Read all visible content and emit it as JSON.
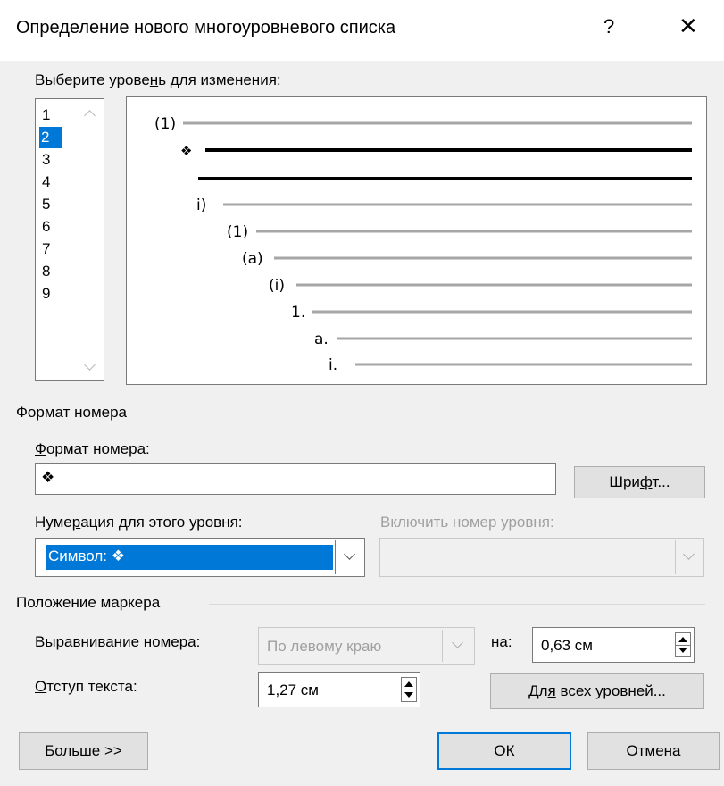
{
  "dialog": {
    "title": "Определение нового многоуровневого списка",
    "help_glyph": "?",
    "close_glyph": "✕"
  },
  "level_select": {
    "label_pre": "Выберите урове",
    "label_u": "н",
    "label_post": "ь для изменения:",
    "levels": [
      "1",
      "2",
      "3",
      "4",
      "5",
      "6",
      "7",
      "8",
      "9"
    ],
    "selected": "2"
  },
  "preview": {
    "rows": [
      {
        "marker": "(1)",
        "style": "gray"
      },
      {
        "marker": "❖",
        "style": "bold"
      },
      {
        "marker": "",
        "style": "bold"
      },
      {
        "marker": "i)",
        "style": "gray"
      },
      {
        "marker": "(1)",
        "style": "gray"
      },
      {
        "marker": "(a)",
        "style": "gray"
      },
      {
        "marker": "(i)",
        "style": "gray"
      },
      {
        "marker": "1.",
        "style": "gray"
      },
      {
        "marker": "a.",
        "style": "gray"
      },
      {
        "marker": "i.",
        "style": "gray"
      }
    ]
  },
  "number_format": {
    "group_label": "Формат номера",
    "format_label_u": "Ф",
    "format_label_post": "ормат номера:",
    "format_value": "❖",
    "font_button_pre": "Шри",
    "font_button_u": "ф",
    "font_button_post": "т...",
    "numbering_label_pre": "Нуме",
    "numbering_label_u": "р",
    "numbering_label_post": "ация для этого уровня:",
    "numbering_value": "Символ: ❖",
    "include_level_label": "Включить номер уровня:"
  },
  "marker_position": {
    "group_label": "Положение маркера",
    "alignment_label_u": "В",
    "alignment_label_post": "ыравнивание номера:",
    "alignment_value": "По левому краю",
    "at_label_pre": "н",
    "at_label_u": "а",
    "at_label_post": ":",
    "at_value": "0,63 см",
    "indent_label_u": "О",
    "indent_label_post": "тступ текста:",
    "indent_value": "1,27 см",
    "all_levels_pre": "Дл",
    "all_levels_u": "я",
    "all_levels_post": " всех уровней..."
  },
  "footer": {
    "more_pre": "Боль",
    "more_u": "ш",
    "more_post": "е >>",
    "ok": "ОК",
    "cancel": "Отмена"
  },
  "colors": {
    "selection": "#0078d7",
    "default_button_border": "#0078d7",
    "dialog_bg": "#f0f0f0"
  }
}
